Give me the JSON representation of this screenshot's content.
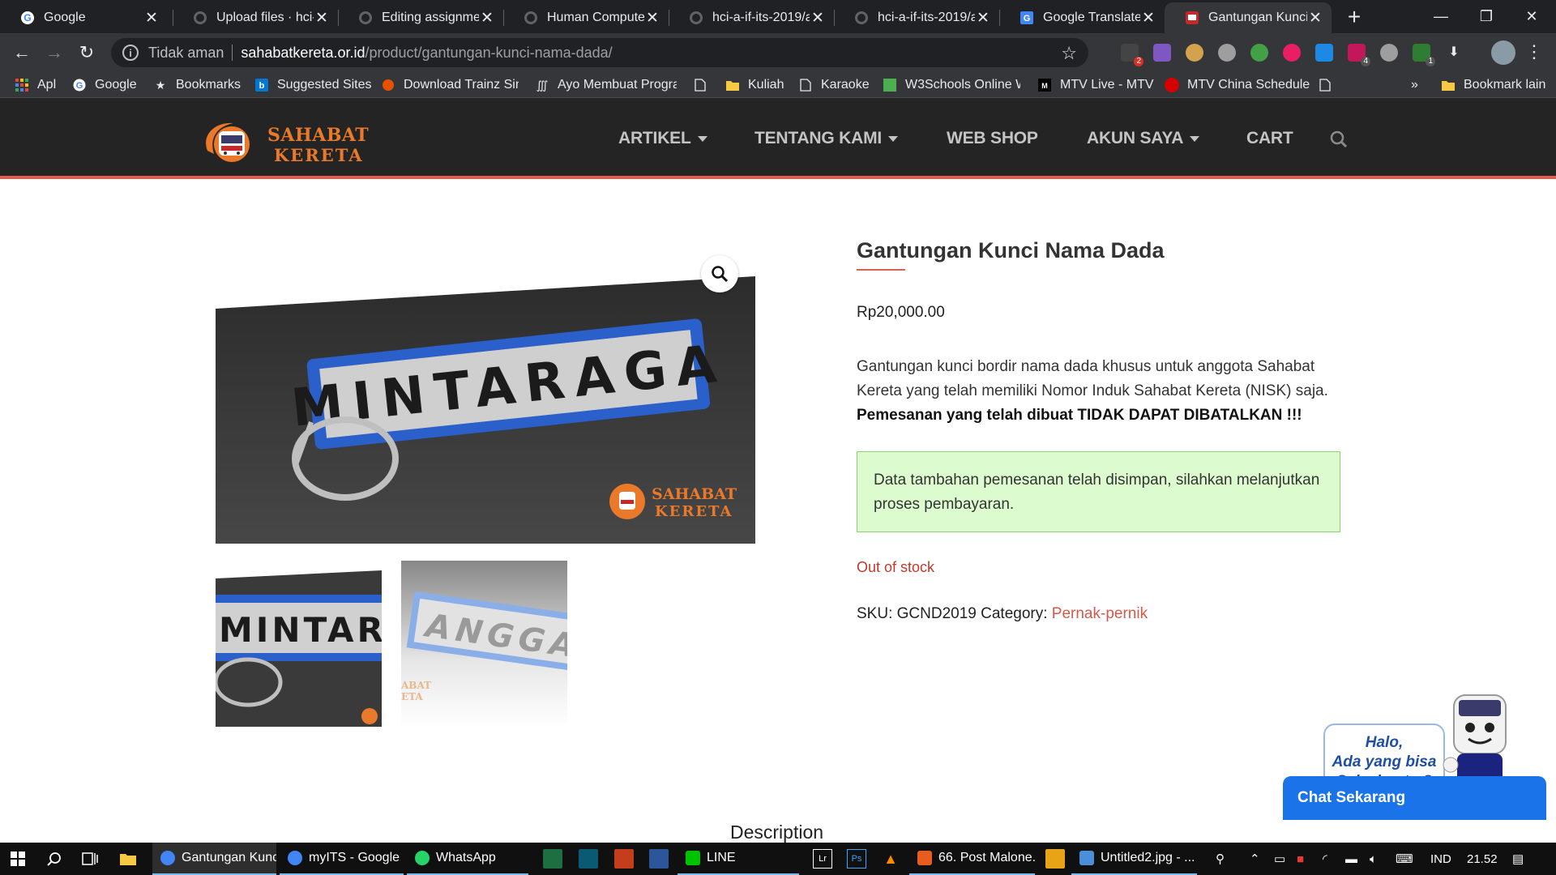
{
  "browser": {
    "tabs": [
      {
        "title": "Google",
        "icon": "google-icon",
        "active": false
      },
      {
        "title": "Upload files · hci-a",
        "icon": "github-icon",
        "active": false
      },
      {
        "title": "Editing assignmen",
        "icon": "github-icon",
        "active": false
      },
      {
        "title": "Human Computer",
        "icon": "github-icon",
        "active": false
      },
      {
        "title": "hci-a-if-its-2019/a",
        "icon": "github-icon",
        "active": false
      },
      {
        "title": "hci-a-if-its-2019/a",
        "icon": "github-icon",
        "active": false
      },
      {
        "title": "Google Translate",
        "icon": "translate-icon",
        "active": false
      },
      {
        "title": "Gantungan Kunci N",
        "icon": "site-favicon",
        "active": true
      }
    ],
    "address": {
      "security_label": "Tidak aman",
      "domain": "sahabatkereta.or.id",
      "path": "/product/gantungan-kunci-nama-dada/"
    },
    "extension_badges": {
      "ext1": "2",
      "ext8": "4",
      "ext10": "1"
    },
    "bookmarks": [
      {
        "label": "Apl",
        "icon": "apps-grid-icon"
      },
      {
        "label": "Google",
        "icon": "google-icon"
      },
      {
        "label": "Bookmarks",
        "icon": "star-icon"
      },
      {
        "label": "Suggested Sites",
        "icon": "bing-icon"
      },
      {
        "label": "Download Trainz Sim",
        "icon": "trainz-icon"
      },
      {
        "label": "Ayo Membuat Progra",
        "icon": "dev-icon"
      },
      {
        "label": "",
        "icon": "page-icon"
      },
      {
        "label": "Kuliah",
        "icon": "folder-icon"
      },
      {
        "label": "Karaoke",
        "icon": "page-icon"
      },
      {
        "label": "W3Schools Online W",
        "icon": "w3schools-icon"
      },
      {
        "label": "MTV Live - MTV",
        "icon": "mtv-icon"
      },
      {
        "label": "MTV China Schedule",
        "icon": "red-circle-icon"
      },
      {
        "label": "",
        "icon": "page-icon"
      }
    ],
    "bookmarks_overflow": "»",
    "bookmarks_other": "Bookmark lain"
  },
  "site": {
    "logo_line1": "SAHABAT",
    "logo_line2": "KERETA",
    "nav": [
      {
        "label": "ARTIKEL",
        "dropdown": true
      },
      {
        "label": "TENTANG KAMI",
        "dropdown": true
      },
      {
        "label": "WEB SHOP",
        "dropdown": false
      },
      {
        "label": "AKUN SAYA",
        "dropdown": true
      },
      {
        "label": "CART",
        "dropdown": false
      }
    ],
    "accent_color": "#e65b4a"
  },
  "product": {
    "image_text": "MINTARAGA",
    "image_watermark1": "SAHABAT",
    "image_watermark2": "KERETA",
    "thumb1_text": "MINTARAG",
    "thumb2_text": "ANGGA",
    "thumb2_watermark": "ABAT",
    "thumb2_watermark2": "ETA",
    "title": "Gantungan Kunci Nama Dada",
    "price": "Rp20,000.00",
    "description": "Gantungan kunci bordir nama dada khusus untuk anggota Sahabat Kereta yang telah memiliki Nomor Induk Sahabat Kereta (NISK) saja. ",
    "description_bold": "Pemesanan yang telah dibuat TIDAK DAPAT DIBATALKAN !!!",
    "notice": "Data tambahan pemesanan telah disimpan, silahkan melanjutkan proses pembayaran.",
    "stock_status": "Out of stock",
    "sku_label": "SKU:",
    "sku": "GCND2019",
    "category_label": "Category:",
    "category": "Pernak-pernik",
    "description_tab": "Description"
  },
  "chat": {
    "bubble_line1": "Halo,",
    "bubble_line2": "Ada yang bisa",
    "bubble_line3": "Sake bantu ?",
    "button": "Chat Sekarang"
  },
  "taskbar": {
    "apps": [
      {
        "label": "Gantungan Kunc...",
        "active": true,
        "color": "#4285f4"
      },
      {
        "label": "myITS - Google ...",
        "active": false,
        "color": "#4285f4"
      },
      {
        "label": "WhatsApp",
        "active": false,
        "color": "#25d366"
      },
      {
        "label": "LINE",
        "active": false,
        "color": "#00c300"
      },
      {
        "label": "66. Post Malone...",
        "active": false,
        "color": "#e85d1e"
      },
      {
        "label": "Untitled2.jpg - ...",
        "active": false,
        "color": "#4a8fd8"
      }
    ],
    "language": "IND",
    "time": "21.52"
  }
}
